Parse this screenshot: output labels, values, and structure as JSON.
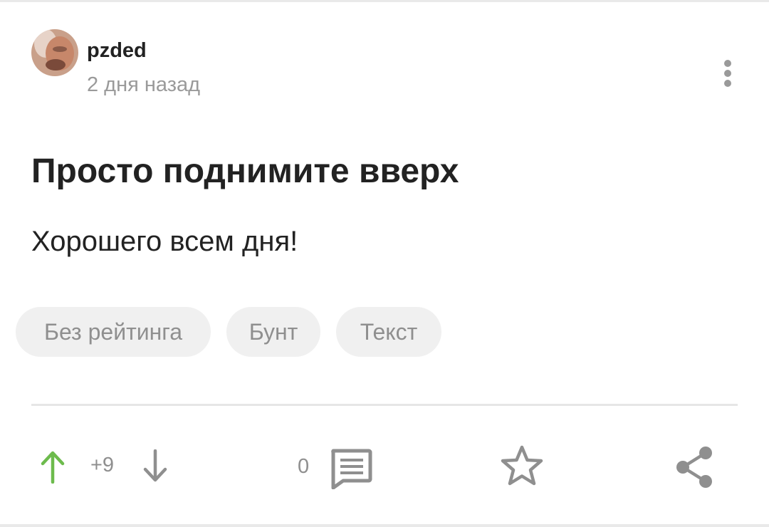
{
  "post": {
    "author": "pzded",
    "time": "2 дня назад",
    "title": "Просто поднимите вверх",
    "body": "Хорошего всем дня!",
    "tags": [
      "Без рейтинга",
      "Бунт",
      "Текст"
    ]
  },
  "actions": {
    "rating": "+9",
    "comments": "0"
  },
  "icons": {
    "upvote": "arrow-up-icon",
    "downvote": "arrow-down-icon",
    "comments": "comment-icon",
    "save": "star-icon",
    "share": "share-icon",
    "more": "more-vertical-icon"
  },
  "colors": {
    "upvote": "#6dbb4d",
    "muted": "#8f8f8f"
  }
}
